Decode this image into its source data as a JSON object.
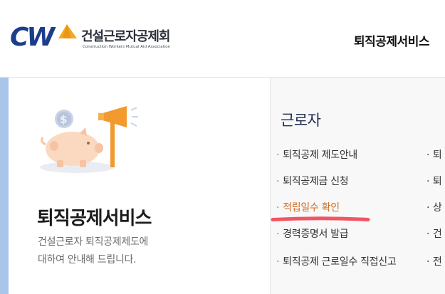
{
  "header": {
    "logo_text_ko": "건설근로자공제회",
    "logo_text_en": "Construction Workers Mutual Aid Association",
    "nav_title": "퇴직공제서비스"
  },
  "left_panel": {
    "title": "퇴직공제서비스",
    "description_line1": "건설근로자 퇴직공제제도에",
    "description_line2": "대하여 안내해 드립니다."
  },
  "right_panel": {
    "section_title": "근로자",
    "menu": [
      {
        "bullet": "·",
        "label": "퇴직공제 제도안내",
        "active": false
      },
      {
        "bullet": "·",
        "label": "퇴직공제금 신청",
        "active": false
      },
      {
        "bullet": "·",
        "label": "적립일수 확인",
        "active": true
      },
      {
        "bullet": "·",
        "label": "경력증명서 발급",
        "active": false
      },
      {
        "bullet": "·",
        "label": "퇴직공제 근로일수 직접신고",
        "active": false
      }
    ],
    "menu_col2": [
      "· 퇴",
      "· 퇴",
      "· 상",
      "· 건",
      "· 전"
    ]
  },
  "colors": {
    "accent_bar": "#a9c5ea",
    "active_item": "#d06a1f",
    "highlight_stroke": "#f0384a",
    "section_title": "#1f2d50"
  }
}
